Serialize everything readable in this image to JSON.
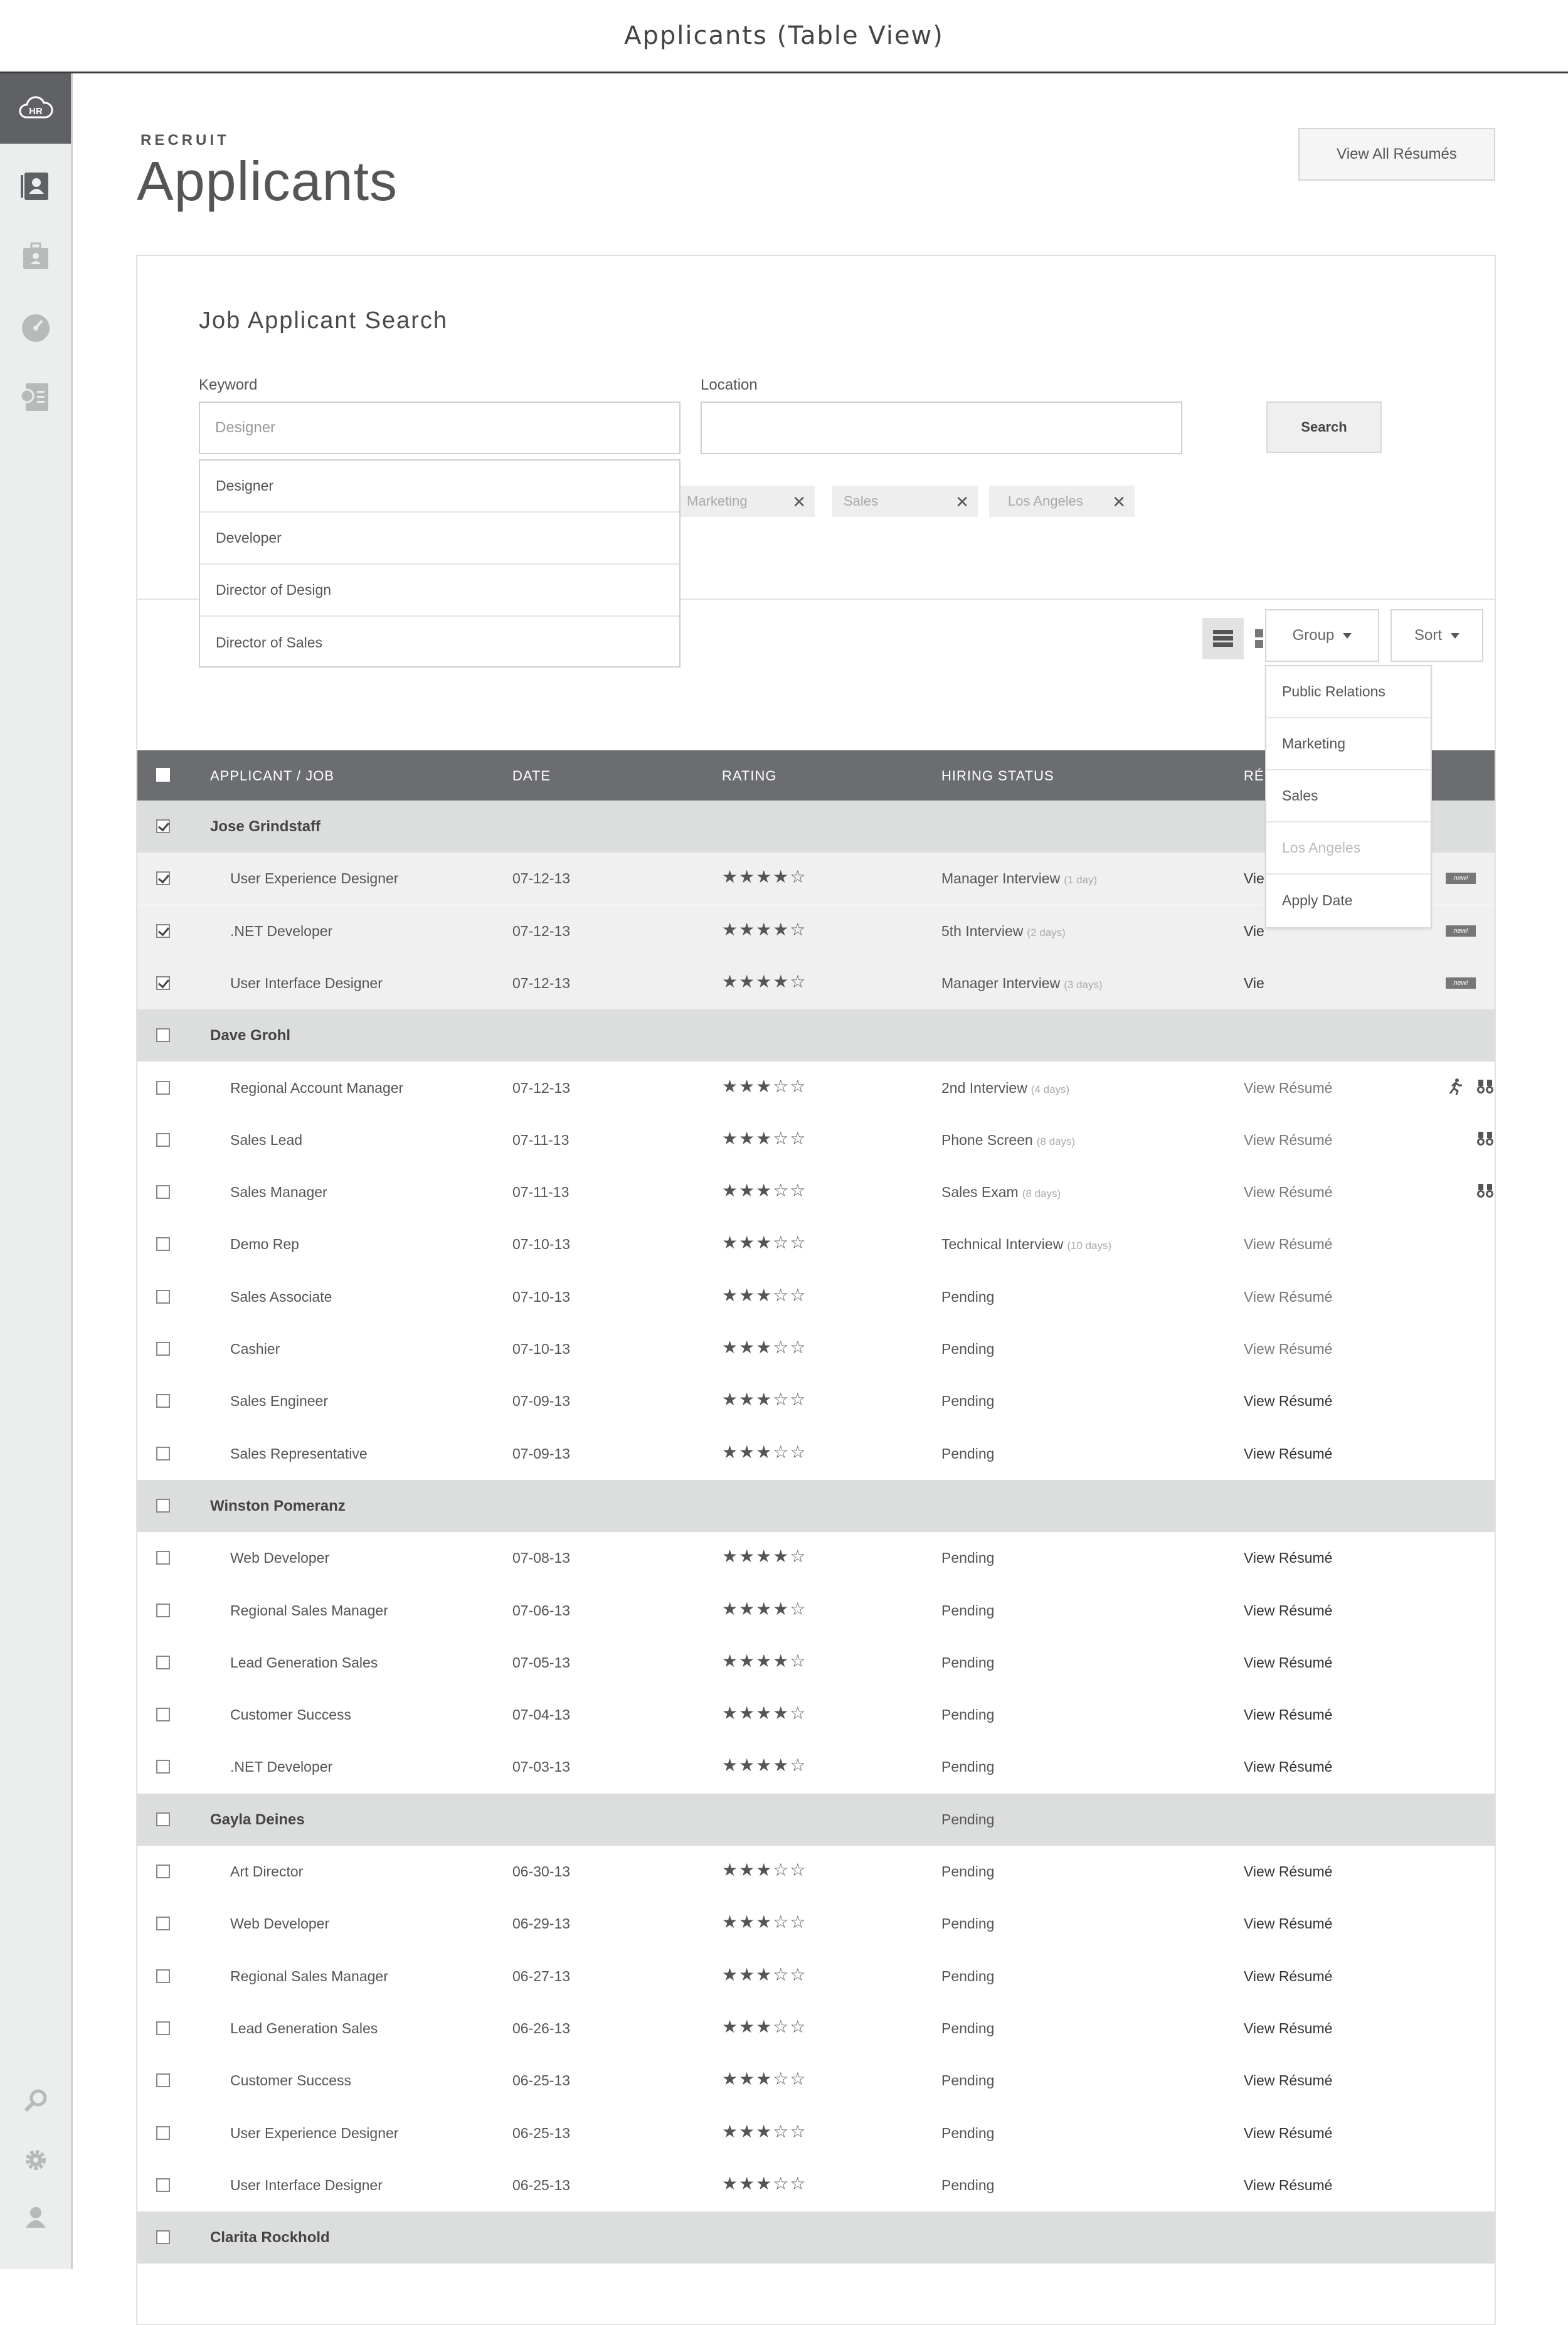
{
  "window_title": "Applicants (Table View)",
  "header": {
    "eyebrow": "RECRUIT",
    "title": "Applicants",
    "view_all_label": "View All Résumés"
  },
  "sidebar": {
    "top_items": [
      "hr-cloud-logo",
      "applicants-icon",
      "jobs-icon",
      "dashboard-icon",
      "reports-icon"
    ],
    "bottom_items": [
      "search-icon",
      "gear-icon",
      "user-icon"
    ]
  },
  "search": {
    "title": "Job Applicant Search",
    "keyword_label": "Keyword",
    "keyword_placeholder": "Designer",
    "location_label": "Location",
    "location_value": "",
    "search_label": "Search",
    "autocomplete": [
      "Designer",
      "Developer",
      "Director of Design",
      "Director of Sales"
    ],
    "filters": [
      "Marketing",
      "Sales",
      "Los Angeles"
    ]
  },
  "toolbar": {
    "group_label": "Group",
    "sort_label": "Sort",
    "group_menu": [
      {
        "label": "Public Relations",
        "disabled": false
      },
      {
        "label": "Marketing",
        "disabled": false
      },
      {
        "label": "Sales",
        "disabled": false
      },
      {
        "label": "Los Angeles",
        "disabled": true
      },
      {
        "label": "Apply Date",
        "disabled": false
      }
    ]
  },
  "table": {
    "columns": [
      "APPLICANT / JOB",
      "DATE",
      "RATING",
      "HIRING STATUS",
      "RÉ"
    ],
    "new_badge": "new!",
    "groups": [
      {
        "name": "Jose Grindstaff",
        "checked": true,
        "status": "",
        "rows": [
          {
            "job": "User Experience Designer",
            "date": "07-12-13",
            "rating": 4,
            "status": "Manager Interview",
            "days": "(1 day)",
            "resume": "Vie",
            "badge": true
          },
          {
            "job": ".NET Developer",
            "date": "07-12-13",
            "rating": 4,
            "status": "5th Interview",
            "days": "(2 days)",
            "resume": "Vie",
            "badge": true
          },
          {
            "job": "User Interface Designer",
            "date": "07-12-13",
            "rating": 4,
            "status": "Manager Interview",
            "days": "(3 days)",
            "resume": "Vie",
            "badge": true
          }
        ]
      },
      {
        "name": "Dave Grohl",
        "checked": false,
        "status": "",
        "rows": [
          {
            "job": "Regional Account Manager",
            "date": "07-12-13",
            "rating": 3,
            "status": "2nd Interview",
            "days": "(4 days)",
            "resume": "View Résumé",
            "icons": [
              "runner-icon",
              "binoculars-icon"
            ]
          },
          {
            "job": "Sales Lead",
            "date": "07-11-13",
            "rating": 3,
            "status": "Phone Screen",
            "days": "(8 days)",
            "resume": "View Résumé",
            "icons": [
              "binoculars-icon"
            ]
          },
          {
            "job": "Sales Manager",
            "date": "07-11-13",
            "rating": 3,
            "status": "Sales Exam",
            "days": "(8 days)",
            "resume": "View Résumé",
            "icons": [
              "binoculars-icon"
            ]
          },
          {
            "job": "Demo Rep",
            "date": "07-10-13",
            "rating": 3,
            "status": "Technical Interview",
            "days": "(10 days)",
            "resume": "View Résumé"
          },
          {
            "job": "Sales Associate",
            "date": "07-10-13",
            "rating": 3,
            "status": "Pending",
            "days": "",
            "resume": "View Résumé"
          },
          {
            "job": "Cashier",
            "date": "07-10-13",
            "rating": 3,
            "status": "Pending",
            "days": "",
            "resume": "View Résumé"
          },
          {
            "job": "Sales Engineer",
            "date": "07-09-13",
            "rating": 3,
            "status": "Pending",
            "days": "",
            "resume": "View Résumé"
          },
          {
            "job": "Sales Representative",
            "date": "07-09-13",
            "rating": 3,
            "status": "Pending",
            "days": "",
            "resume": "View Résumé"
          }
        ]
      },
      {
        "name": "Winston Pomeranz",
        "checked": false,
        "status": "",
        "rows": [
          {
            "job": "Web Developer",
            "date": "07-08-13",
            "rating": 4,
            "status": "Pending",
            "days": "",
            "resume": "View Résumé"
          },
          {
            "job": "Regional Sales Manager",
            "date": "07-06-13",
            "rating": 4,
            "status": "Pending",
            "days": "",
            "resume": "View Résumé"
          },
          {
            "job": "Lead Generation Sales",
            "date": "07-05-13",
            "rating": 4,
            "status": "Pending",
            "days": "",
            "resume": "View Résumé"
          },
          {
            "job": "Customer Success",
            "date": "07-04-13",
            "rating": 4,
            "status": "Pending",
            "days": "",
            "resume": "View Résumé"
          },
          {
            "job": ".NET Developer",
            "date": "07-03-13",
            "rating": 4,
            "status": "Pending",
            "days": "",
            "resume": "View Résumé"
          }
        ]
      },
      {
        "name": "Gayla Deines",
        "checked": false,
        "status": "Pending",
        "rows": [
          {
            "job": "Art Director",
            "date": "06-30-13",
            "rating": 3,
            "status": "Pending",
            "days": "",
            "resume": "View Résumé"
          },
          {
            "job": "Web Developer",
            "date": "06-29-13",
            "rating": 3,
            "status": "Pending",
            "days": "",
            "resume": "View Résumé"
          },
          {
            "job": "Regional Sales Manager",
            "date": "06-27-13",
            "rating": 3,
            "status": "Pending",
            "days": "",
            "resume": "View Résumé"
          },
          {
            "job": "Lead Generation Sales",
            "date": "06-26-13",
            "rating": 3,
            "status": "Pending",
            "days": "",
            "resume": "View Résumé"
          },
          {
            "job": "Customer Success",
            "date": "06-25-13",
            "rating": 3,
            "status": "Pending",
            "days": "",
            "resume": "View Résumé"
          },
          {
            "job": "User Experience Designer",
            "date": "06-25-13",
            "rating": 3,
            "status": "Pending",
            "days": "",
            "resume": "View Résumé"
          },
          {
            "job": "User Interface Designer",
            "date": "06-25-13",
            "rating": 3,
            "status": "Pending",
            "days": "",
            "resume": "View Résumé"
          }
        ]
      },
      {
        "name": "Clarita Rockhold",
        "checked": false,
        "status": "",
        "rows": []
      }
    ]
  }
}
